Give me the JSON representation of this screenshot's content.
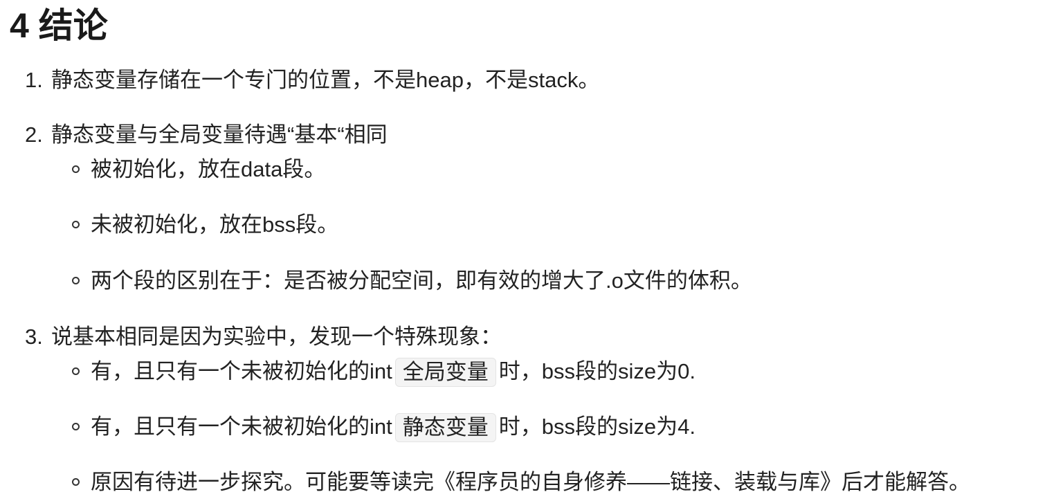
{
  "heading": "4 结论",
  "items": [
    {
      "num": "1.",
      "text": "静态变量存储在一个专门的位置，不是heap，不是stack。"
    },
    {
      "num": "2.",
      "text": "静态变量与全局变量待遇“基本“相同",
      "sub": [
        {
          "text": "被初始化，放在data段。"
        },
        {
          "text": "未被初始化，放在bss段。"
        },
        {
          "text": "两个段的区别在于：是否被分配空间，即有效的增大了.o文件的体积。"
        }
      ]
    },
    {
      "num": "3.",
      "text": "说基本相同是因为实验中，发现一个特殊现象：",
      "sub": [
        {
          "before": "有，且只有一个未被初始化的int",
          "code": "全局变量",
          "after": "时，bss段的size为0."
        },
        {
          "before": "有，且只有一个未被初始化的int",
          "code": "静态变量",
          "after": "时，bss段的size为4."
        },
        {
          "text": "原因有待进一步探究。可能要等读完《程序员的自身修养——链接、装载与库》后才能解答。"
        }
      ]
    }
  ]
}
